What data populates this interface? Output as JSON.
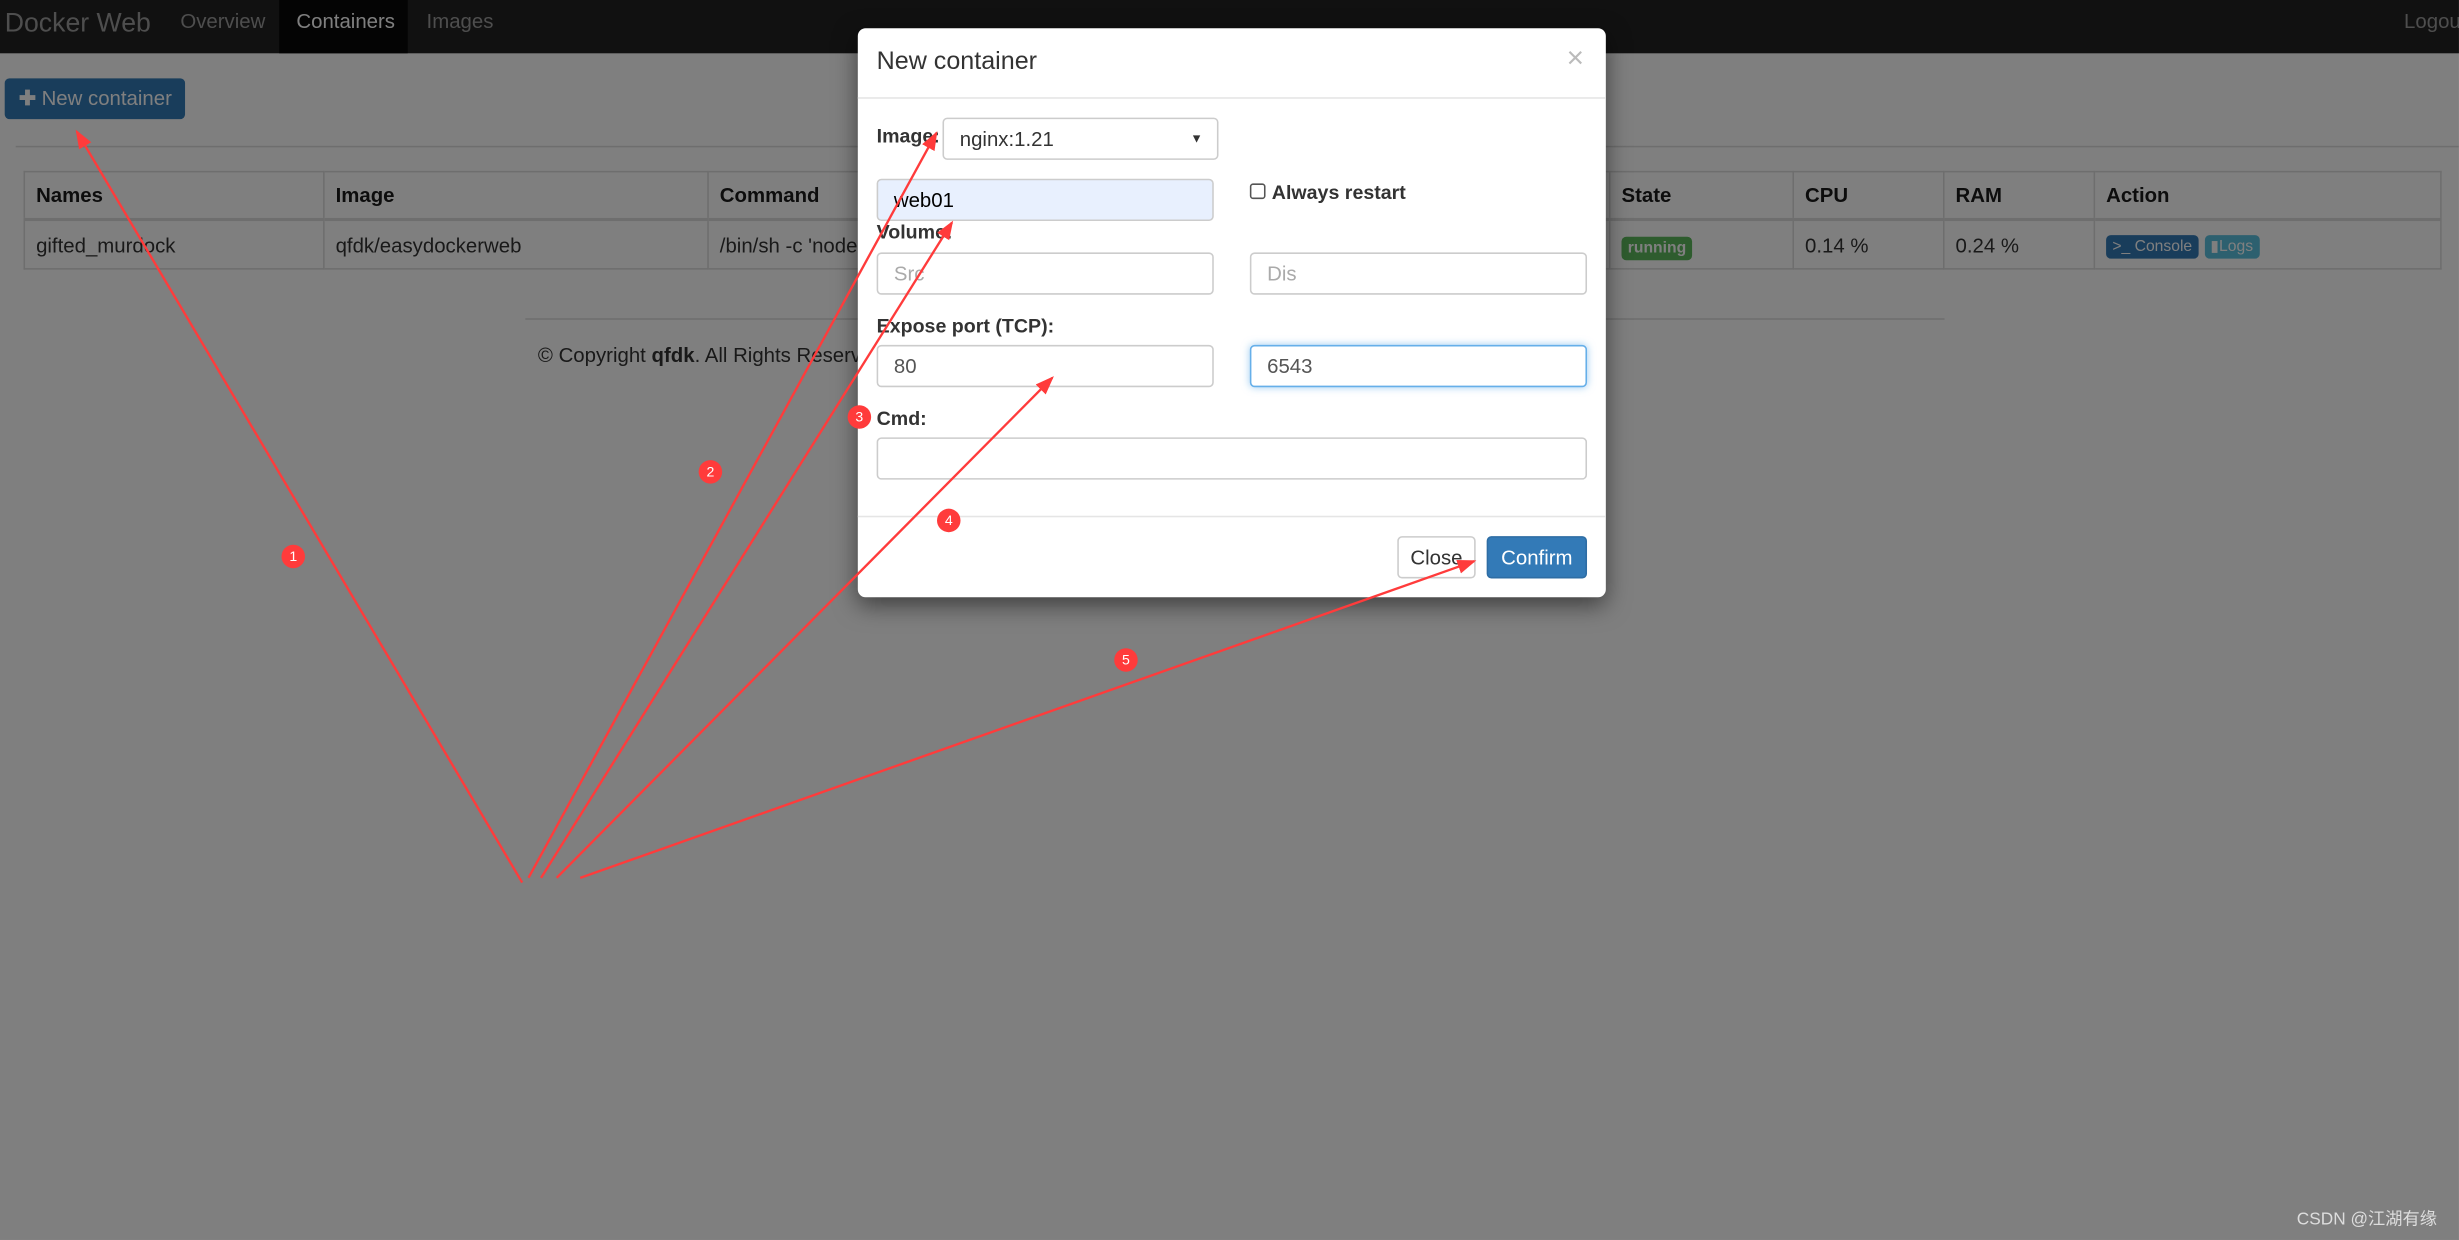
{
  "navbar": {
    "brand": "Docker Web",
    "tabs": [
      {
        "label": "Overview"
      },
      {
        "label": "Containers",
        "active": true
      },
      {
        "label": "Images"
      }
    ],
    "logout": "Logou"
  },
  "toolbar": {
    "new_container": "New container",
    "icon": "plus-icon"
  },
  "table": {
    "headers": [
      "Names",
      "Image",
      "Command",
      "State",
      "CPU",
      "RAM",
      "Action"
    ],
    "rows": [
      {
        "name": "gifted_murdock",
        "image": "qfdk/easydockerweb",
        "command": "/bin/sh -c 'node",
        "state": "running",
        "cpu": "0.14 %",
        "ram": "0.24 %",
        "actions": [
          "Console",
          "Logs"
        ]
      }
    ]
  },
  "footer": {
    "prefix": "© Copyright ",
    "owner": "qfdk",
    "suffix": ". All Rights Reserve"
  },
  "modal": {
    "title": "New container",
    "close_icon": "×",
    "image_label": "Image:",
    "image_value": "nginx:1.21",
    "name_value": "web01",
    "always_restart": "Always restart",
    "always_restart_checked": false,
    "volume_label": "Volume:",
    "src_placeholder": "Src",
    "dis_placeholder": "Dis",
    "port_label": "Expose port (TCP):",
    "port_container": "80",
    "port_host": "6543",
    "cmd_label": "Cmd:",
    "cmd_value": "",
    "close_button": "Close",
    "confirm_button": "Confirm"
  },
  "annotations": [
    "1",
    "2",
    "3",
    "4",
    "5"
  ],
  "watermark": "CSDN @江湖有缘",
  "colors": {
    "primary": "#337ab7",
    "success": "#5cb85c",
    "info": "#5bc0de",
    "annotation": "#ff3b3b"
  }
}
